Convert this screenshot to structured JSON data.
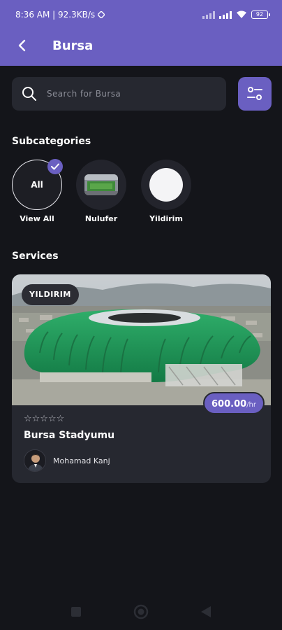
{
  "status": {
    "time_speed": "8:36 AM | 92.3KB/s",
    "battery": "92"
  },
  "header": {
    "title": "Bursa"
  },
  "search": {
    "placeholder": "Search for Bursa"
  },
  "subcategories": {
    "title": "Subcategories",
    "items": [
      {
        "circle_text": "All",
        "label": "View All",
        "selected": true
      },
      {
        "label": "Nulufer",
        "selected": false
      },
      {
        "label": "Yildirim",
        "selected": false
      }
    ]
  },
  "services": {
    "title": "Services",
    "cards": [
      {
        "tag": "YILDIRIM",
        "price": "600.00",
        "price_unit": "/hr",
        "rating": 0,
        "stars": "☆☆☆☆☆",
        "name": "Bursa Stadyumu",
        "owner": "Mohamad Kanj"
      }
    ]
  },
  "colors": {
    "accent": "#6a5fc1",
    "background": "#14151a",
    "surface": "#262830"
  },
  "icons": {
    "back": "chevron-left-icon",
    "search": "search-icon",
    "filter": "sliders-icon",
    "check": "check-icon"
  }
}
